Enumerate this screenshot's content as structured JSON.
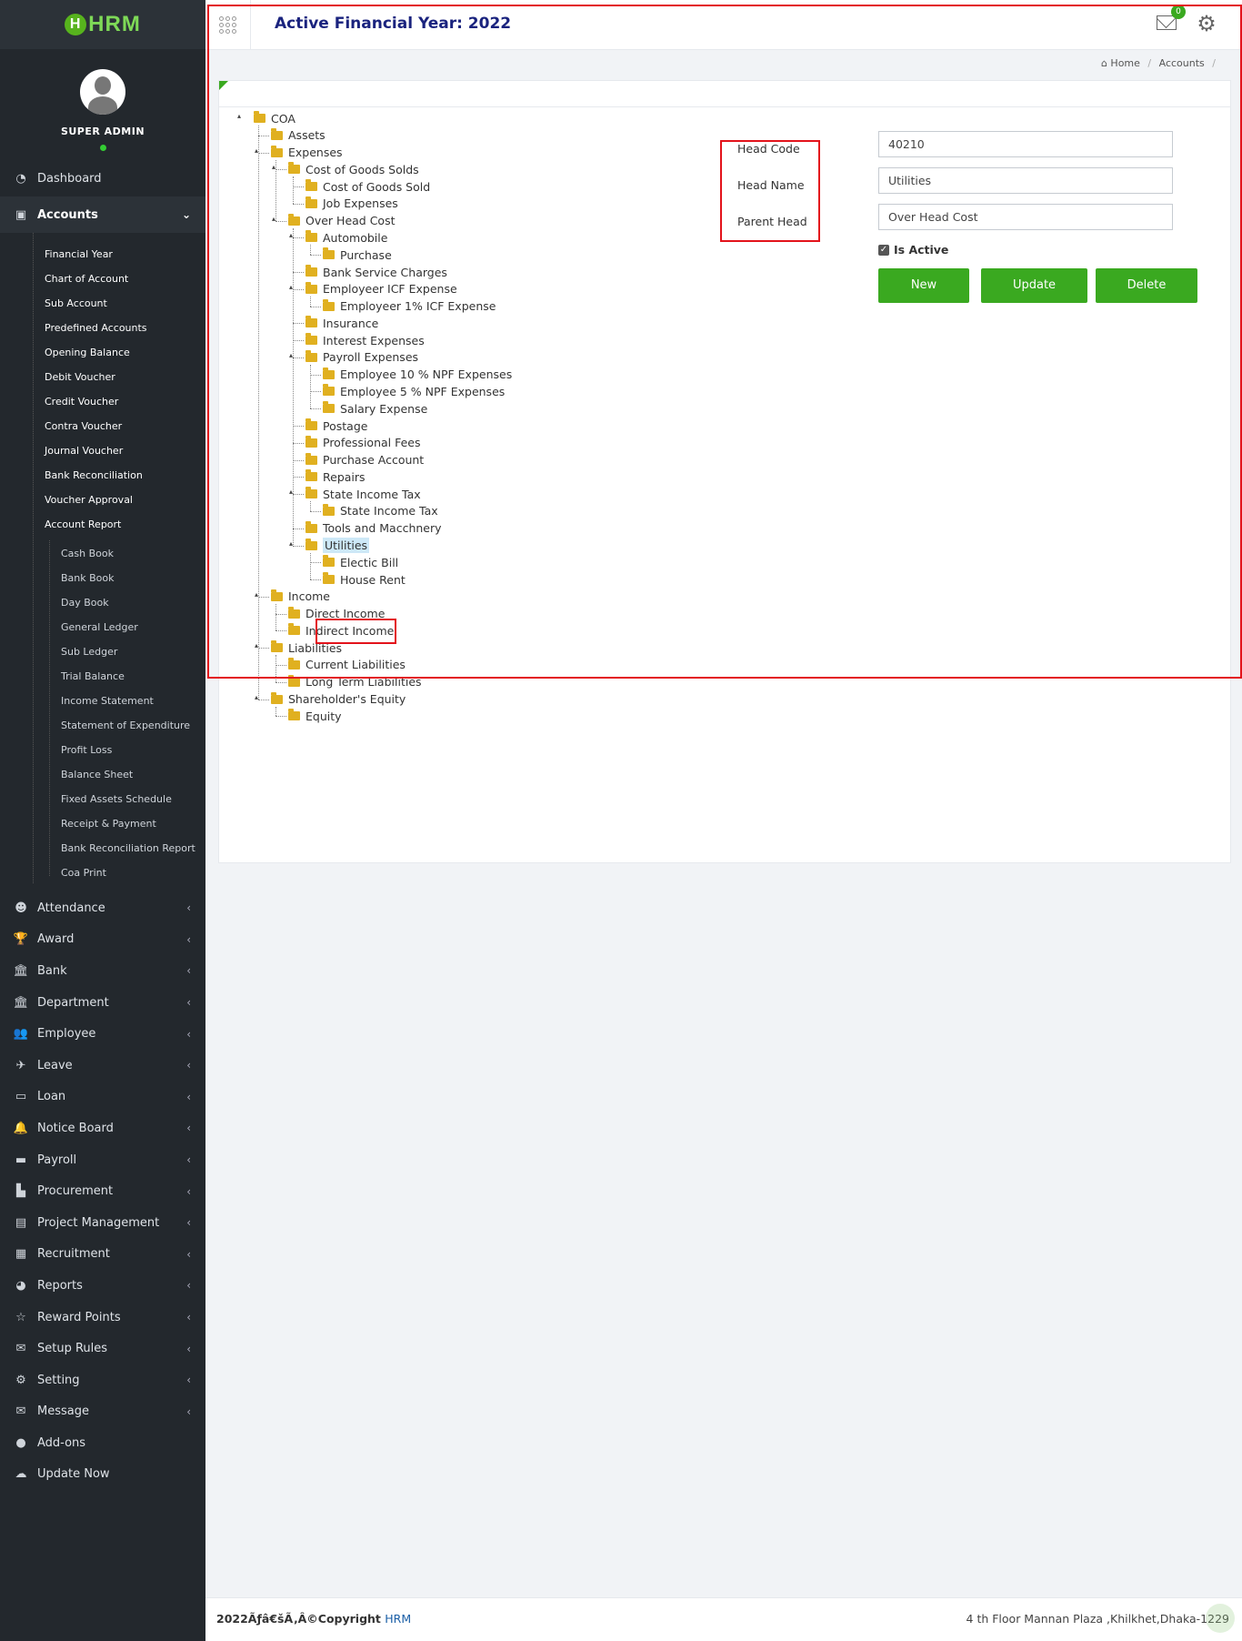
{
  "app": {
    "logo": "HRM",
    "logo_letter": "H"
  },
  "profile": {
    "name": "SUPER ADMIN"
  },
  "header": {
    "title": "Active Financial Year: 2022",
    "mail_count": "0"
  },
  "breadcrumb": {
    "home": "Home",
    "current": "Accounts"
  },
  "nav": {
    "dashboard": "Dashboard",
    "accounts": "Accounts",
    "accounts_sub": [
      "Financial Year",
      "Chart of Account",
      "Sub Account",
      "Predefined Accounts",
      "Opening Balance",
      "Debit Voucher",
      "Credit Voucher",
      "Contra Voucher",
      "Journal Voucher",
      "Bank Reconciliation",
      "Voucher Approval",
      "Account Report"
    ],
    "report_sub": [
      "Cash Book",
      "Bank Book",
      "Day Book",
      "General Ledger",
      "Sub Ledger",
      "Trial Balance",
      "Income Statement",
      "Statement of Expenditure",
      "Profit Loss",
      "Balance Sheet",
      "Fixed Assets Schedule",
      "Receipt & Payment",
      "Bank Reconciliation Report",
      "Coa Print"
    ],
    "others": [
      "Attendance",
      "Award",
      "Bank",
      "Department",
      "Employee",
      "Leave",
      "Loan",
      "Notice Board",
      "Payroll",
      "Procurement",
      "Project Management",
      "Recruitment",
      "Reports",
      "Reward Points",
      "Setup Rules",
      "Setting",
      "Message",
      "Add-ons",
      "Update Now"
    ]
  },
  "tree": [
    {
      "label": "COA",
      "depth": 0
    },
    {
      "label": "Assets",
      "depth": 1
    },
    {
      "label": "Expenses",
      "depth": 1
    },
    {
      "label": "Cost of Goods Solds",
      "depth": 2
    },
    {
      "label": "Cost of Goods Sold",
      "depth": 3
    },
    {
      "label": "Job Expenses",
      "depth": 3
    },
    {
      "label": "Over Head Cost",
      "depth": 2
    },
    {
      "label": "Automobile",
      "depth": 3
    },
    {
      "label": "Purchase",
      "depth": 4
    },
    {
      "label": "Bank Service Charges",
      "depth": 3
    },
    {
      "label": "Employeer ICF Expense",
      "depth": 3
    },
    {
      "label": "Employeer 1% ICF Expense",
      "depth": 4
    },
    {
      "label": "Insurance",
      "depth": 3
    },
    {
      "label": "Interest Expenses",
      "depth": 3
    },
    {
      "label": "Payroll Expenses",
      "depth": 3
    },
    {
      "label": "Employee 10 % NPF Expenses",
      "depth": 4
    },
    {
      "label": "Employee 5 % NPF Expenses",
      "depth": 4
    },
    {
      "label": "Salary Expense",
      "depth": 4
    },
    {
      "label": "Postage",
      "depth": 3
    },
    {
      "label": "Professional Fees",
      "depth": 3
    },
    {
      "label": "Purchase Account",
      "depth": 3
    },
    {
      "label": "Repairs",
      "depth": 3
    },
    {
      "label": "State Income Tax",
      "depth": 3
    },
    {
      "label": "State Income Tax",
      "depth": 4
    },
    {
      "label": "Tools and Macchnery",
      "depth": 3
    },
    {
      "label": "Utilities",
      "depth": 3,
      "selected": true
    },
    {
      "label": "Electic Bill",
      "depth": 4
    },
    {
      "label": "House Rent",
      "depth": 4
    },
    {
      "label": "Income",
      "depth": 1
    },
    {
      "label": "Direct Income",
      "depth": 2
    },
    {
      "label": "Indirect Income",
      "depth": 2
    },
    {
      "label": "Liabilities",
      "depth": 1
    },
    {
      "label": "Current Liabilities",
      "depth": 2
    },
    {
      "label": "Long Term Liabilities",
      "depth": 2
    },
    {
      "label": "Shareholder's Equity",
      "depth": 1
    },
    {
      "label": "Equity",
      "depth": 2
    }
  ],
  "form": {
    "head_code_label": "Head Code",
    "head_name_label": "Head Name",
    "parent_head_label": "Parent Head",
    "head_code": "40210",
    "head_name": "Utilities",
    "parent_head": "Over Head Cost",
    "is_active_label": "Is Active",
    "new_label": "New",
    "update_label": "Update",
    "delete_label": "Delete"
  },
  "footer": {
    "copyright": "2022Ãƒâ€šÃ‚Â©Copyright",
    "brand": "HRM",
    "address": "4 th Floor Mannan Plaza ,Khilkhet,Dhaka-1229"
  },
  "colors": {
    "sidebar": "#23282d",
    "accent": "#3aa920",
    "title": "#1a237e",
    "highlight": "#e3131b"
  }
}
